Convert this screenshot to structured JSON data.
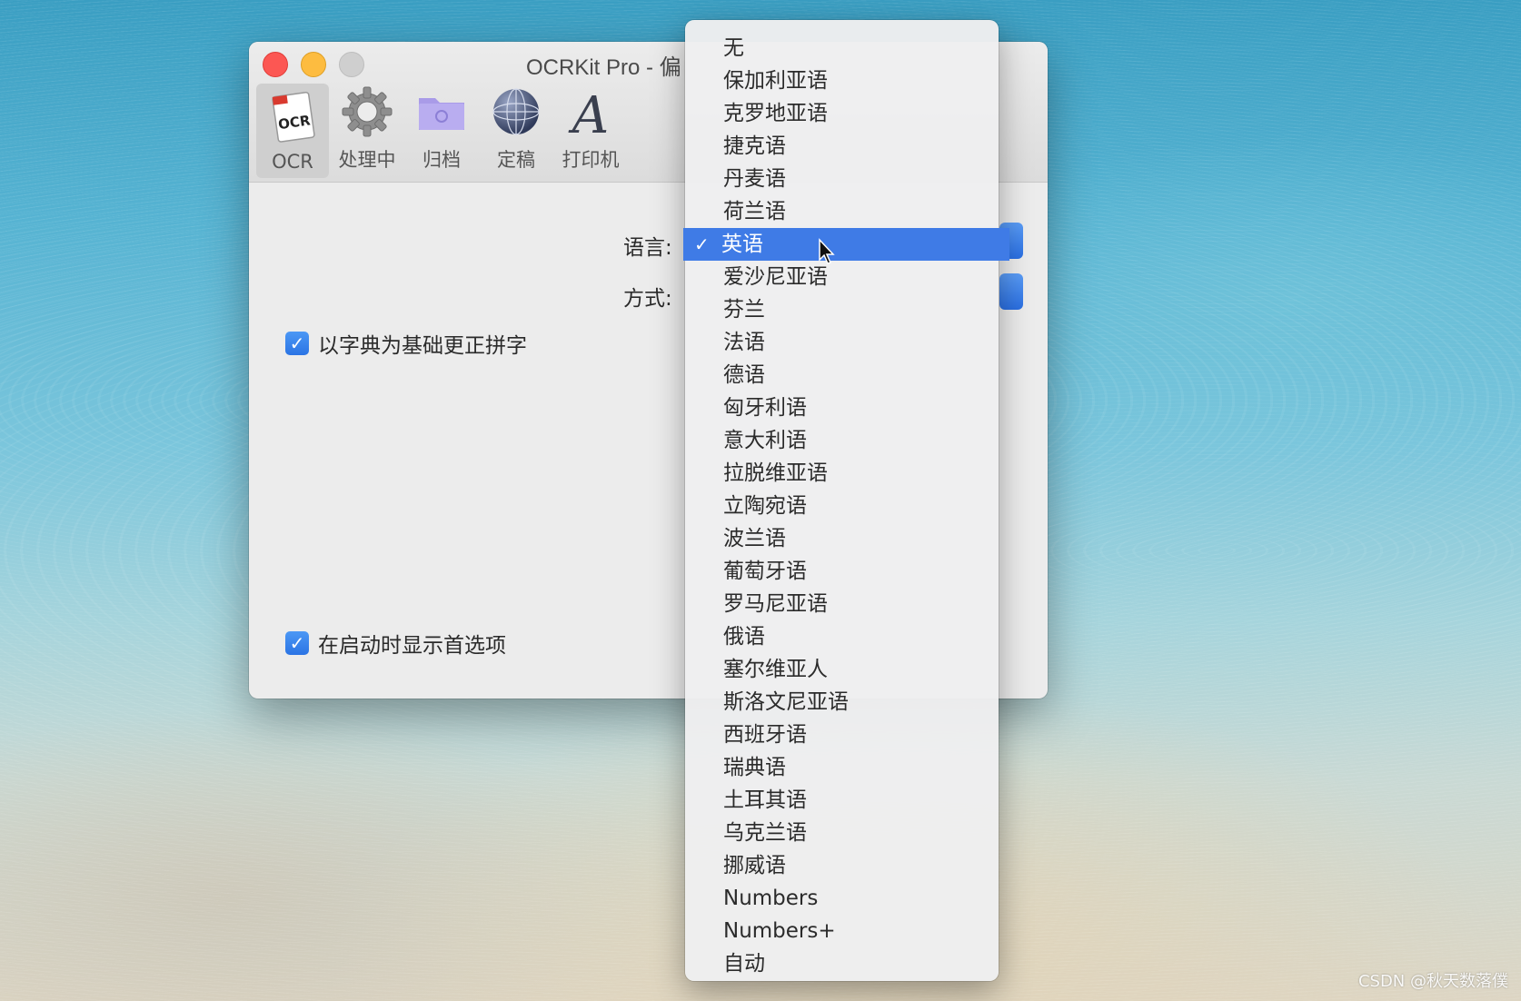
{
  "window": {
    "title": "OCRKit Pro - 偏",
    "toolbar": [
      {
        "label": "OCR",
        "icon": "ocr-document-icon"
      },
      {
        "label": "处理中",
        "icon": "gear-icon"
      },
      {
        "label": "归档",
        "icon": "folder-icon"
      },
      {
        "label": "定稿",
        "icon": "globe-icon"
      },
      {
        "label": "打印机",
        "icon": "font-a-icon"
      }
    ],
    "language_label": "语言:",
    "method_label": "方式:",
    "checkbox_spellcheck": {
      "label": "以字典为基础更正拼字",
      "checked": true
    },
    "checkbox_show_prefs": {
      "label": "在启动时显示首选项",
      "checked": true
    }
  },
  "language_menu": {
    "selected": "英语",
    "items": [
      "无",
      "保加利亚语",
      "克罗地亚语",
      "捷克语",
      "丹麦语",
      "荷兰语",
      "英语",
      "爱沙尼亚语",
      "芬兰",
      "法语",
      "德语",
      "匈牙利语",
      "意大利语",
      "拉脱维亚语",
      "立陶宛语",
      "波兰语",
      "葡萄牙语",
      "罗马尼亚语",
      "俄语",
      "塞尔维亚人",
      "斯洛文尼亚语",
      "西班牙语",
      "瑞典语",
      "土耳其语",
      "乌克兰语",
      "挪威语",
      "Numbers",
      "Numbers+",
      "自动"
    ]
  },
  "watermark": "CSDN @秋天数落僕",
  "colors": {
    "accent": "#3f7be6",
    "close": "#fc5753",
    "minimize": "#fdbc40"
  }
}
